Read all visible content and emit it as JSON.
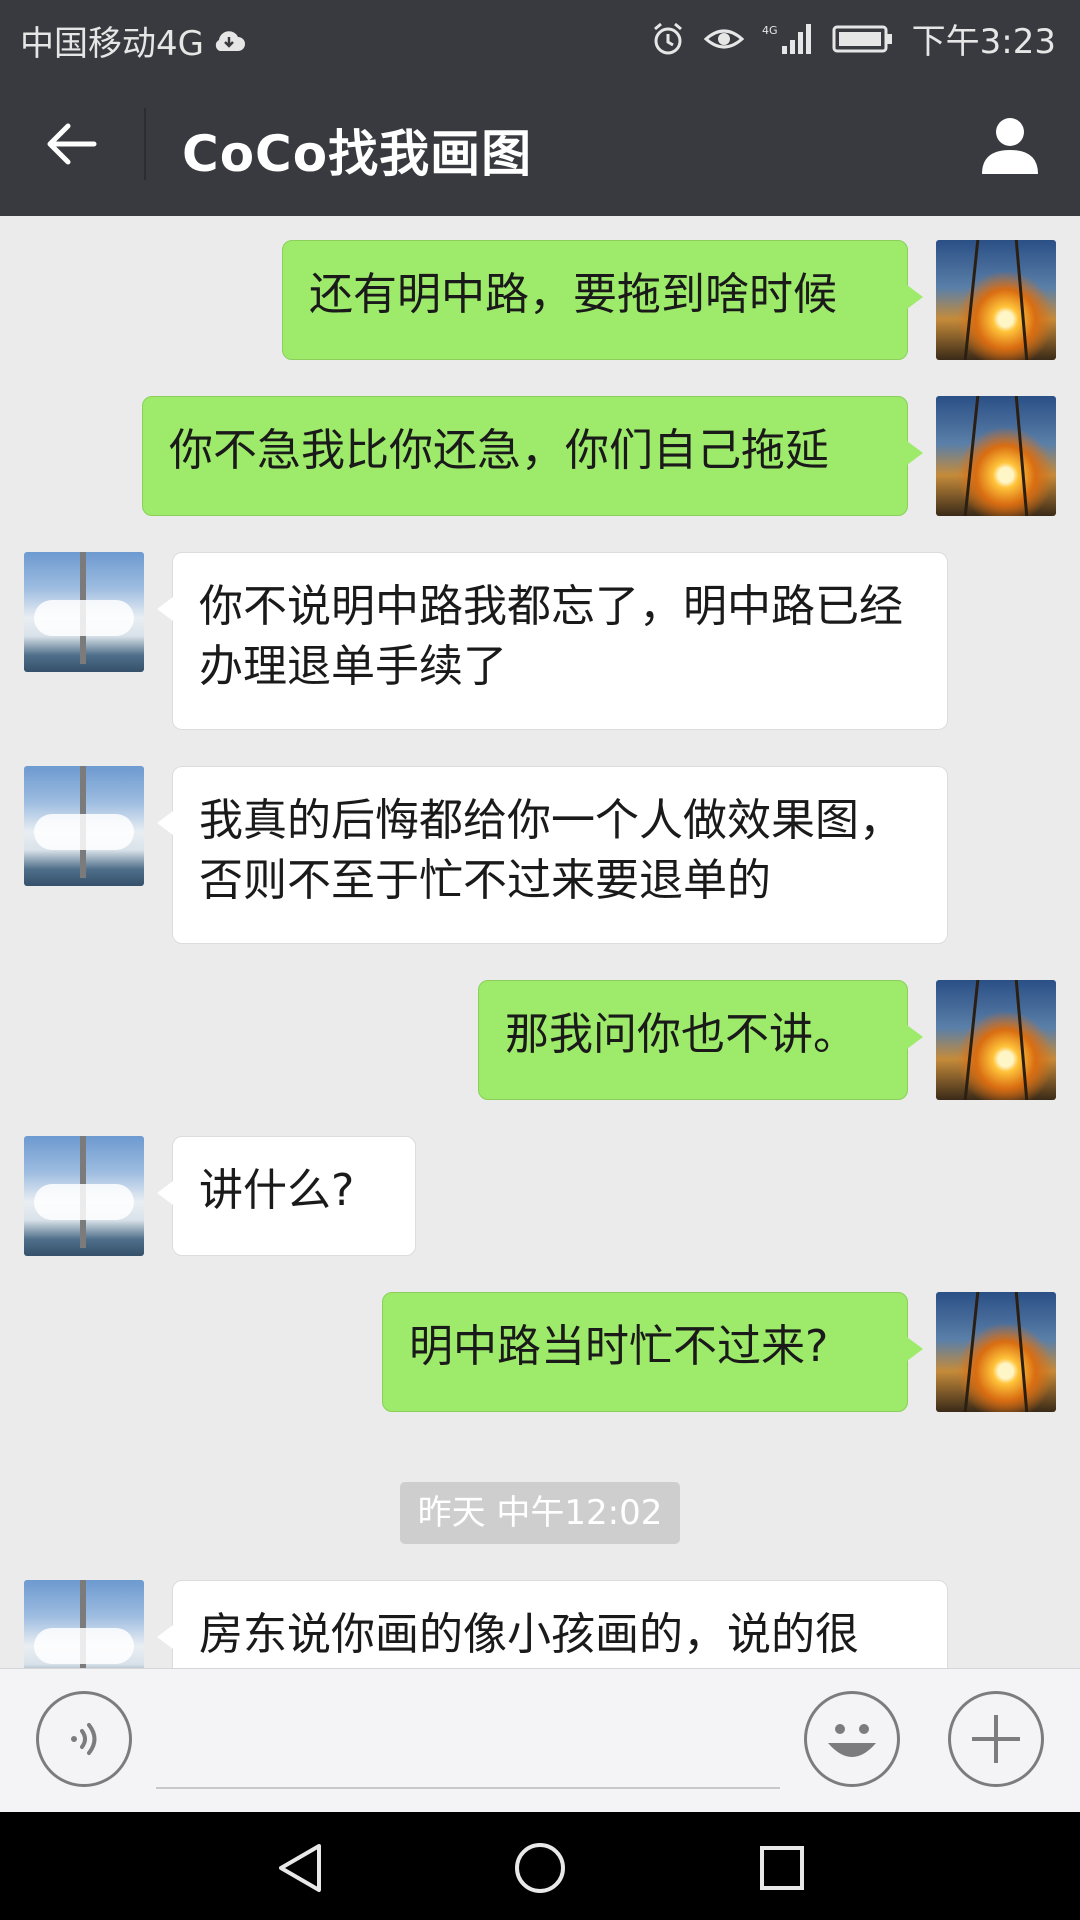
{
  "status_bar": {
    "carrier": "中国移动4G",
    "network": "4G",
    "time": "下午3:23",
    "icons": [
      "cloud-icon",
      "alarm-icon",
      "eye-icon",
      "signal-icon",
      "battery-icon"
    ]
  },
  "header": {
    "title": "CoCo找我画图",
    "back_icon": "arrow-left-icon",
    "profile_icon": "person-icon"
  },
  "messages": [
    {
      "side": "out",
      "text": "还有明中路，要拖到啥时候",
      "avatar": "sunset-avatar"
    },
    {
      "side": "out",
      "text": "你不急我比你还急，你们自己拖延",
      "avatar": "sunset-avatar"
    },
    {
      "side": "in",
      "text": "你不说明中路我都忘了，明中路已经办理退单手续了",
      "avatar": "sky-avatar"
    },
    {
      "side": "in",
      "text": "我真的后悔都给你一个人做效果图，否则不至于忙不过来要退单的",
      "avatar": "sky-avatar"
    },
    {
      "side": "out",
      "text": "那我问你也不讲。",
      "avatar": "sunset-avatar"
    },
    {
      "side": "in",
      "text": "讲什么?",
      "avatar": "sky-avatar"
    },
    {
      "side": "out",
      "text": "明中路当时忙不过来?",
      "avatar": "sunset-avatar"
    },
    {
      "side": "in",
      "text": "房东说你画的像小孩画的，说的很",
      "avatar": "sky-avatar"
    }
  ],
  "timestamp": "昨天 中午12:02",
  "input_bar": {
    "voice_icon": "voice-icon",
    "emoji_icon": "emoji-icon",
    "plus_icon": "plus-icon"
  },
  "nav_bar": {
    "icons": [
      "back-triangle-icon",
      "home-circle-icon",
      "recents-square-icon"
    ]
  }
}
